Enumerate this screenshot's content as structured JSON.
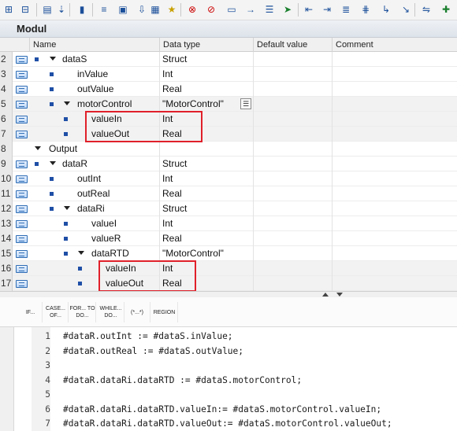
{
  "toolbar": {
    "icons": [
      "insert-row-icon",
      "move-down-icon",
      "window-icon",
      "properties-icon",
      "show-all-icon",
      "monitor-icon",
      "star-icon",
      "add-breakpoint-icon",
      "remove-breakpoint-icon",
      "window-list-icon",
      "close-gap-icon",
      "download-icon",
      "indent-left-icon",
      "indent-right-icon",
      "align-icon",
      "branch-icon",
      "jump-icon",
      "bookmark-icon",
      "run-icon"
    ]
  },
  "title": "Modul",
  "columns": {
    "name": "Name",
    "data_type": "Data type",
    "default_value": "Default value",
    "comment": "Comment"
  },
  "rows": [
    {
      "num": "2",
      "name": "dataS",
      "type": "Struct"
    },
    {
      "num": "3",
      "name": "inValue",
      "type": "Int"
    },
    {
      "num": "4",
      "name": "outValue",
      "type": "Real"
    },
    {
      "num": "5",
      "name": "motorControl",
      "type": "\"MotorControl\""
    },
    {
      "num": "6",
      "name": "valueIn",
      "type": "Int"
    },
    {
      "num": "7",
      "name": "valueOut",
      "type": "Real"
    },
    {
      "num": "8",
      "name": "Output",
      "type": ""
    },
    {
      "num": "9",
      "name": "dataR",
      "type": "Struct"
    },
    {
      "num": "10",
      "name": "outInt",
      "type": "Int"
    },
    {
      "num": "11",
      "name": "outReal",
      "type": "Real"
    },
    {
      "num": "12",
      "name": "dataRi",
      "type": "Struct"
    },
    {
      "num": "13",
      "name": "valueI",
      "type": "Int"
    },
    {
      "num": "14",
      "name": "valueR",
      "type": "Real"
    },
    {
      "num": "15",
      "name": "dataRTD",
      "type": "\"MotorControl\""
    },
    {
      "num": "16",
      "name": "valueIn",
      "type": "Int"
    },
    {
      "num": "17",
      "name": "valueOut",
      "type": "Real"
    }
  ],
  "dropdown_glyph": "☰",
  "scl_toolbar": [
    {
      "label": "IF..."
    },
    {
      "label": "CASE... OF..."
    },
    {
      "label": "FOR... TO DO..."
    },
    {
      "label": "WHILE... DO..."
    },
    {
      "label": "(*...*)"
    },
    {
      "label": "REGION"
    }
  ],
  "code_lines": [
    {
      "num": "1",
      "text": "#dataR.outInt := #dataS.inValue;"
    },
    {
      "num": "2",
      "text": "#dataR.outReal := #dataS.outValue;"
    },
    {
      "num": "3",
      "text": ""
    },
    {
      "num": "4",
      "text": "#dataR.dataRi.dataRTD := #dataS.motorControl;"
    },
    {
      "num": "5",
      "text": ""
    },
    {
      "num": "6",
      "text": "#dataR.dataRi.dataRTD.valueIn:= #dataS.motorControl.valueIn;"
    },
    {
      "num": "7",
      "text": "#dataR.dataRi.dataRTD.valueOut:= #dataS.motorControl.valueOut;"
    }
  ]
}
